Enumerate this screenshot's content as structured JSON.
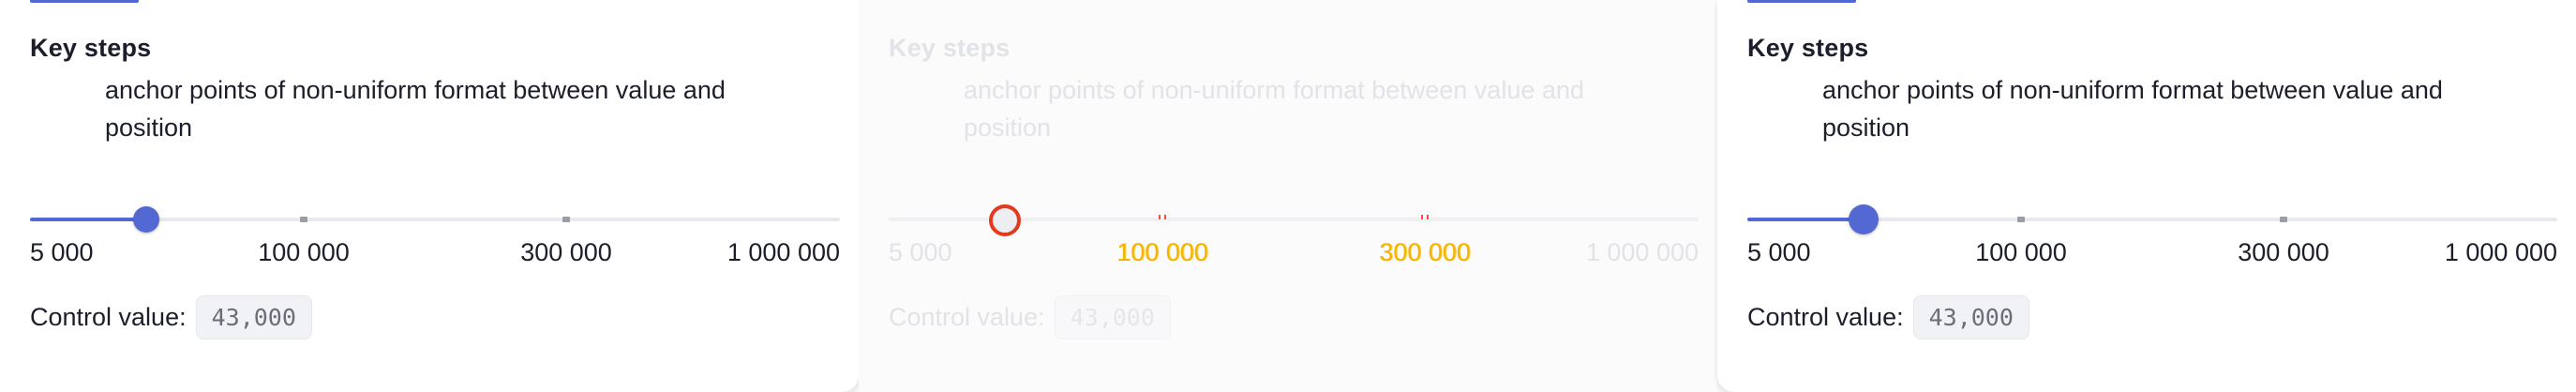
{
  "panels": [
    {
      "title": "Key steps",
      "description": "anchor points of non-uniform format between value and position",
      "slider": {
        "value": 43000,
        "marks": [
          "5 000",
          "100 000",
          "300 000",
          "1 000 000"
        ],
        "accent": "#5468d4"
      },
      "control_label": "Control value:",
      "control_value": "43,000"
    },
    {
      "title": "Key steps",
      "description": "anchor points of non-uniform format between value and position",
      "slider": {
        "value": 43000,
        "marks": [
          "5 000",
          "100 000",
          "300 000",
          "1 000 000"
        ],
        "accent": "#e33a1e"
      },
      "control_label": "Control value:",
      "control_value": "43,000"
    },
    {
      "title": "Key steps",
      "description": "anchor points of non-uniform format between value and position",
      "slider": {
        "value": 43000,
        "marks": [
          "5 000",
          "100 000",
          "300 000",
          "1 000 000"
        ],
        "accent": "#5468d4"
      },
      "control_label": "Control value:",
      "control_value": "43,000"
    }
  ]
}
